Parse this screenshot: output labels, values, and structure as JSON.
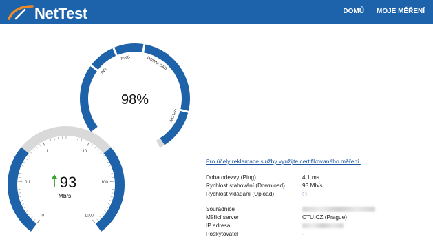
{
  "app": {
    "name": "NetTest"
  },
  "nav": {
    "home": "DOMŮ",
    "my_measurements": "MOJE MĚŘENÍ"
  },
  "progress_gauge": {
    "percent_text": "98%",
    "progress_fraction": 0.98,
    "phases": [
      "INIT",
      "PING",
      "DOWNLOAD",
      "UPLOAD"
    ]
  },
  "speed_gauge": {
    "value": "93",
    "unit": "Mb/s",
    "direction_icon": "up-arrow-icon",
    "tick_labels": [
      "0",
      "0,1",
      "1",
      "10",
      "100",
      "1000"
    ]
  },
  "complaint_link": "Pro účely reklamace služby využijte certifikovaného měření.",
  "results": [
    {
      "label": "Doba odezvy (Ping)",
      "value": "4,1 ms"
    },
    {
      "label": "Rychlost stahování (Download)",
      "value": "93 Mb/s"
    },
    {
      "label": "Rychlost vkládání (Upload)",
      "value": ""
    }
  ],
  "details": [
    {
      "label": "Souřadnice",
      "value": ""
    },
    {
      "label": "Měřicí server",
      "value": "CTU.CZ (Prague)"
    },
    {
      "label": "IP adresa",
      "value": ""
    },
    {
      "label": "Poskytovatel",
      "value": "-"
    }
  ],
  "colors": {
    "header": "#1d63ac",
    "gauge_blue": "#1e62aa",
    "gauge_track": "#d9d9d9",
    "up_arrow": "#3aa635",
    "logo_swoosh": "#f08a24"
  }
}
